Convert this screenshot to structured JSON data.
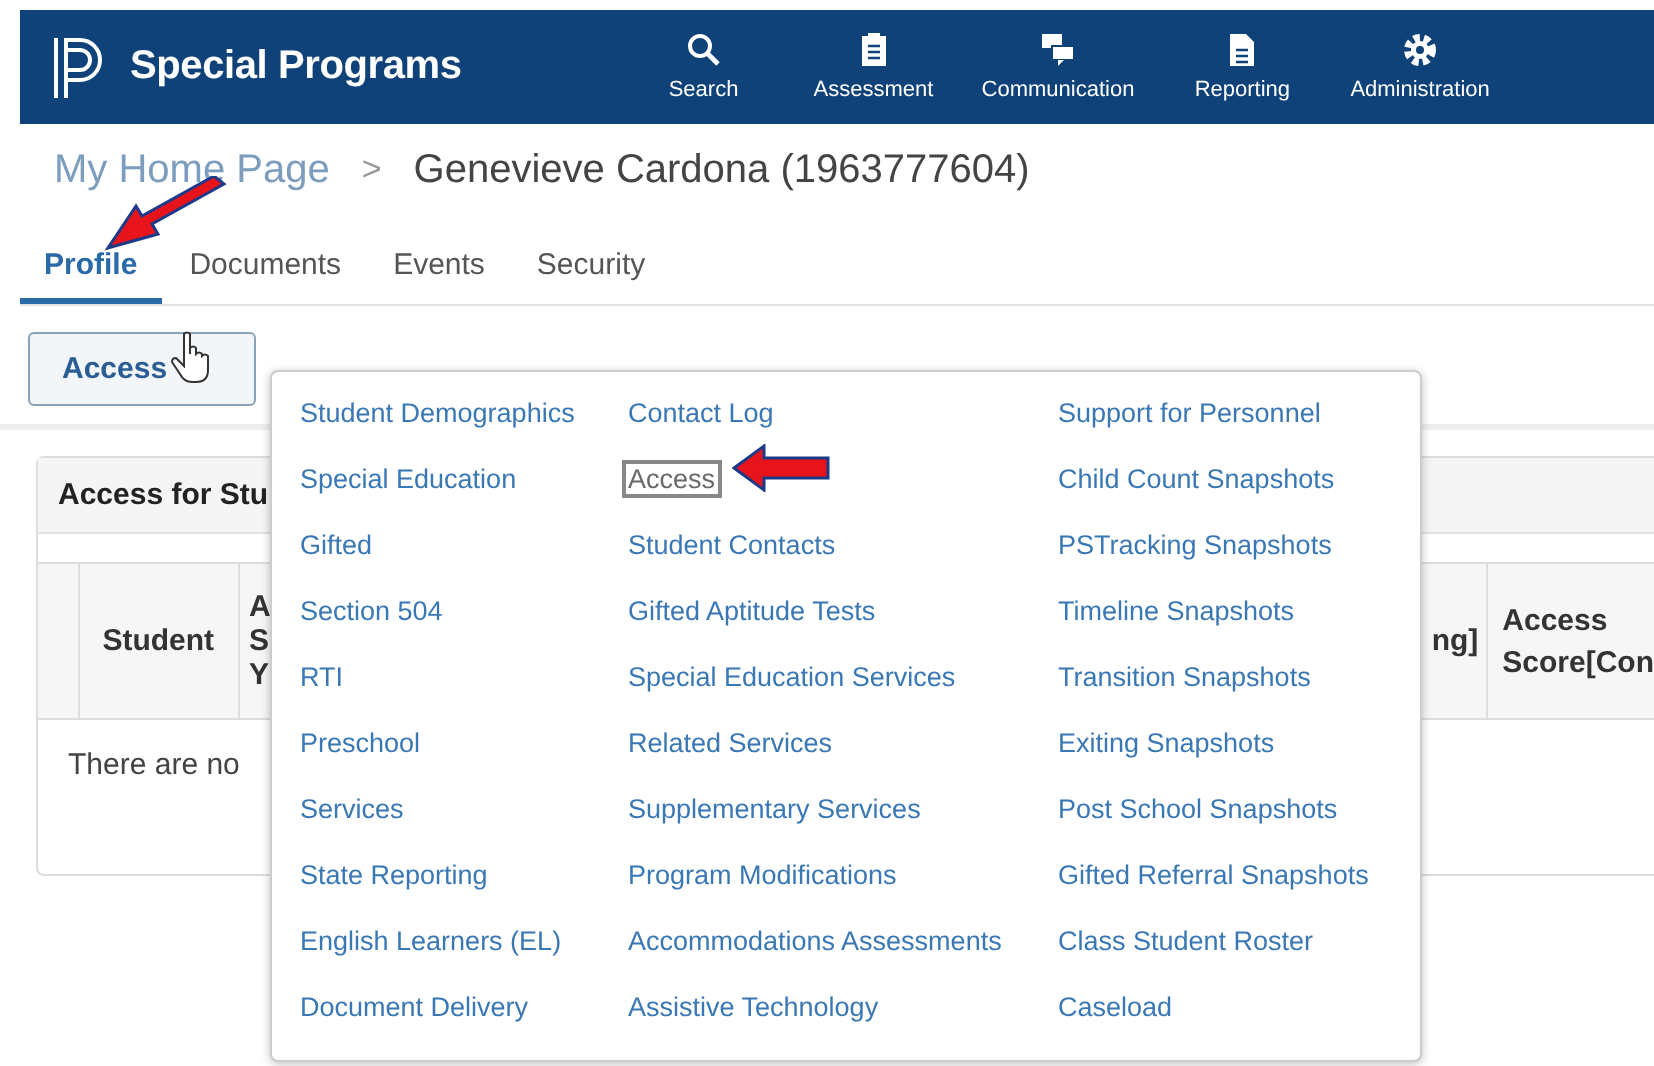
{
  "header": {
    "title": "Special Programs",
    "nav": [
      {
        "kind": "search",
        "label": "Search"
      },
      {
        "kind": "clipboard",
        "label": "Assessment"
      },
      {
        "kind": "chat",
        "label": "Communication"
      },
      {
        "kind": "document",
        "label": "Reporting"
      },
      {
        "kind": "gear",
        "label": "Administration"
      }
    ]
  },
  "breadcrumb": {
    "parent": "My Home Page",
    "separator": ">",
    "current": "Genevieve Cardona (1963777604)"
  },
  "tabs": [
    {
      "label": "Profile",
      "selected": true
    },
    {
      "label": "Documents",
      "selected": false
    },
    {
      "label": "Events",
      "selected": false
    },
    {
      "label": "Security",
      "selected": false
    }
  ],
  "access_button": {
    "label": "Access"
  },
  "panel": {
    "title": "Access for Stu",
    "columns": [
      {
        "lines": [
          "Student"
        ]
      },
      {
        "lines": [
          "A",
          "S",
          "Y"
        ]
      },
      {
        "lines": [
          "ng]"
        ]
      },
      {
        "lines": [
          "Access",
          "Score[Con"
        ]
      }
    ],
    "empty_message": "There are no"
  },
  "menu": {
    "columns": [
      [
        {
          "label": "Student Demographics",
          "selected": false
        },
        {
          "label": "Special Education",
          "selected": false
        },
        {
          "label": "Gifted",
          "selected": false
        },
        {
          "label": "Section 504",
          "selected": false
        },
        {
          "label": "RTI",
          "selected": false
        },
        {
          "label": "Preschool",
          "selected": false
        },
        {
          "label": "Services",
          "selected": false
        },
        {
          "label": "State Reporting",
          "selected": false
        },
        {
          "label": "English Learners (EL)",
          "selected": false
        },
        {
          "label": "Document Delivery",
          "selected": false
        }
      ],
      [
        {
          "label": "Contact Log",
          "selected": false
        },
        {
          "label": "Access",
          "selected": true
        },
        {
          "label": "Student Contacts",
          "selected": false
        },
        {
          "label": "Gifted Aptitude Tests",
          "selected": false
        },
        {
          "label": "Special Education Services",
          "selected": false
        },
        {
          "label": "Related Services",
          "selected": false
        },
        {
          "label": "Supplementary Services",
          "selected": false
        },
        {
          "label": "Program Modifications",
          "selected": false
        },
        {
          "label": "Accommodations Assessments",
          "selected": false
        },
        {
          "label": "Assistive Technology",
          "selected": false
        }
      ],
      [
        {
          "label": "Support for Personnel",
          "selected": false
        },
        {
          "label": "Child Count Snapshots",
          "selected": false
        },
        {
          "label": "PSTracking Snapshots",
          "selected": false
        },
        {
          "label": "Timeline Snapshots",
          "selected": false
        },
        {
          "label": "Transition Snapshots",
          "selected": false
        },
        {
          "label": "Exiting Snapshots",
          "selected": false
        },
        {
          "label": "Post School Snapshots",
          "selected": false
        },
        {
          "label": "Gifted Referral Snapshots",
          "selected": false
        },
        {
          "label": "Class Student Roster",
          "selected": false
        },
        {
          "label": "Caseload",
          "selected": false
        }
      ]
    ]
  }
}
